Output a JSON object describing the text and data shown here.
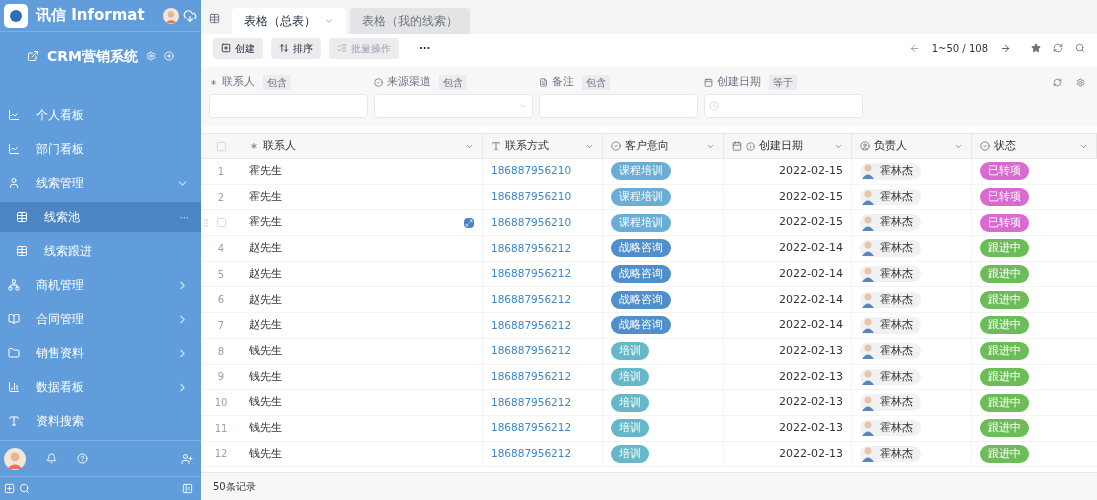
{
  "app": {
    "name": "讯信 Informat"
  },
  "sidebar": {
    "title": "CRM营销系统",
    "items": [
      {
        "label": "个人看板",
        "selected": false
      },
      {
        "label": "部门看板",
        "selected": false
      },
      {
        "label": "线索管理",
        "selected": false,
        "expanded": true,
        "children": [
          {
            "label": "线索池",
            "selected": true,
            "more": "···"
          },
          {
            "label": "线索跟进",
            "selected": false
          }
        ]
      },
      {
        "label": "商机管理",
        "selected": false,
        "expanded": false
      },
      {
        "label": "合同管理",
        "selected": false,
        "expanded": false
      },
      {
        "label": "销售资料",
        "selected": false,
        "expanded": false
      },
      {
        "label": "数据看板",
        "selected": false,
        "expanded": false
      },
      {
        "label": "资料搜索",
        "selected": false
      }
    ]
  },
  "tabs": [
    {
      "label": "表格（总表）",
      "selected": true
    },
    {
      "label": "表格（我的线索）",
      "selected": false
    }
  ],
  "toolbar": {
    "buttons": [
      {
        "label": "创建",
        "disabled": false
      },
      {
        "label": "排序",
        "disabled": false
      },
      {
        "label": "批量操作",
        "disabled": true
      }
    ],
    "more": "···",
    "pagination": "1~50 / 108"
  },
  "filters": [
    {
      "label": "联系人",
      "op": "包含",
      "kind": "text"
    },
    {
      "label": "来源渠道",
      "op": "包含",
      "kind": "select"
    },
    {
      "label": "备注",
      "op": "包含",
      "kind": "note"
    },
    {
      "label": "创建日期",
      "op": "等于",
      "kind": "date"
    }
  ],
  "table": {
    "select_all": {
      "checked": false
    },
    "columns": [
      "联系人",
      "联系方式",
      "客户意向",
      "创建日期",
      "负责人",
      "状态"
    ],
    "rows": [
      {
        "number": "1",
        "hovered": false,
        "name": "霍先生",
        "phone": "186887956210",
        "intent": {
          "label": "课程培训",
          "color": "#6aaed8"
        },
        "date": "2022-02-15",
        "owner": "霍林杰",
        "status": {
          "label": "已转项",
          "color": "#d86ad0"
        }
      },
      {
        "number": "2",
        "hovered": false,
        "name": "霍先生",
        "phone": "186887956210",
        "intent": {
          "label": "课程培训",
          "color": "#6aaed8"
        },
        "date": "2022-02-15",
        "owner": "霍林杰",
        "status": {
          "label": "已转项",
          "color": "#d86ad0"
        }
      },
      {
        "hovered": true,
        "checked": false,
        "name": "霍先生",
        "phone": "186887956210",
        "intent": {
          "label": "课程培训",
          "color": "#6aaed8"
        },
        "date": "2022-02-15",
        "owner": "霍林杰",
        "status": {
          "label": "已转项",
          "color": "#d86ad0"
        }
      },
      {
        "number": "4",
        "hovered": false,
        "name": "赵先生",
        "phone": "186887956212",
        "intent": {
          "label": "战略咨询",
          "color": "#4f8fcc"
        },
        "date": "2022-02-14",
        "owner": "霍林杰",
        "status": {
          "label": "跟进中",
          "color": "#6cbd5a"
        }
      },
      {
        "number": "5",
        "hovered": false,
        "name": "赵先生",
        "phone": "186887956212",
        "intent": {
          "label": "战略咨询",
          "color": "#4f8fcc"
        },
        "date": "2022-02-14",
        "owner": "霍林杰",
        "status": {
          "label": "跟进中",
          "color": "#6cbd5a"
        }
      },
      {
        "number": "6",
        "hovered": false,
        "name": "赵先生",
        "phone": "186887956212",
        "intent": {
          "label": "战略咨询",
          "color": "#4f8fcc"
        },
        "date": "2022-02-14",
        "owner": "霍林杰",
        "status": {
          "label": "跟进中",
          "color": "#6cbd5a"
        }
      },
      {
        "number": "7",
        "hovered": false,
        "name": "赵先生",
        "phone": "186887956212",
        "intent": {
          "label": "战略咨询",
          "color": "#4f8fcc"
        },
        "date": "2022-02-14",
        "owner": "霍林杰",
        "status": {
          "label": "跟进中",
          "color": "#6cbd5a"
        }
      },
      {
        "number": "8",
        "hovered": false,
        "name": "钱先生",
        "phone": "186887956212",
        "intent": {
          "label": "培训",
          "color": "#66b8c8"
        },
        "date": "2022-02-13",
        "owner": "霍林杰",
        "status": {
          "label": "跟进中",
          "color": "#6cbd5a"
        }
      },
      {
        "number": "9",
        "hovered": false,
        "name": "钱先生",
        "phone": "186887956212",
        "intent": {
          "label": "培训",
          "color": "#66b8c8"
        },
        "date": "2022-02-13",
        "owner": "霍林杰",
        "status": {
          "label": "跟进中",
          "color": "#6cbd5a"
        }
      },
      {
        "number": "10",
        "hovered": false,
        "name": "钱先生",
        "phone": "186887956212",
        "intent": {
          "label": "培训",
          "color": "#66b8c8"
        },
        "date": "2022-02-13",
        "owner": "霍林杰",
        "status": {
          "label": "跟进中",
          "color": "#6cbd5a"
        }
      },
      {
        "number": "11",
        "hovered": false,
        "name": "钱先生",
        "phone": "186887956212",
        "intent": {
          "label": "培训",
          "color": "#66b8c8"
        },
        "date": "2022-02-13",
        "owner": "霍林杰",
        "status": {
          "label": "跟进中",
          "color": "#6cbd5a"
        }
      },
      {
        "number": "12",
        "hovered": false,
        "name": "钱先生",
        "phone": "186887956212",
        "intent": {
          "label": "培训",
          "color": "#66b8c8"
        },
        "date": "2022-02-13",
        "owner": "霍林杰",
        "status": {
          "label": "跟进中",
          "color": "#6cbd5a"
        }
      }
    ],
    "footer": "50条记录"
  }
}
